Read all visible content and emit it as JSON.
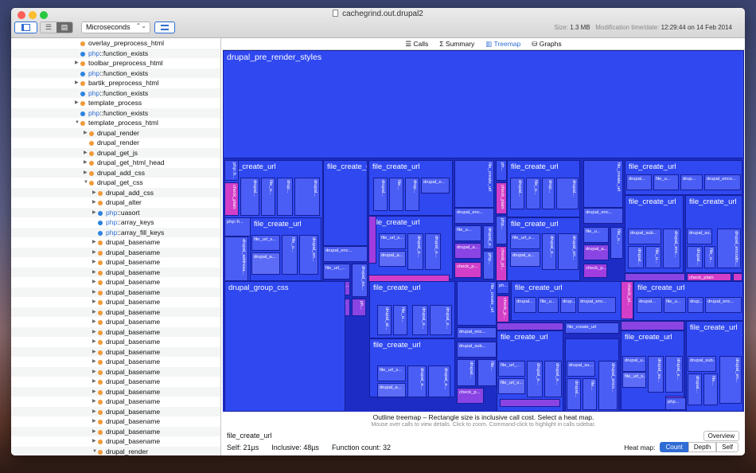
{
  "window": {
    "title": "cachegrind.out.drupal2",
    "traffic": [
      "#fc5f57",
      "#fdbc2e",
      "#28c840"
    ]
  },
  "toolbar": {
    "unit_select": "Microseconds",
    "size_label": "Size:",
    "size_value": "1.3 MB",
    "mtime_label": "Modification time/date:",
    "mtime_value": "12:29:44 on 14 Feb 2014"
  },
  "tabs": [
    "Calls",
    "Summary",
    "Treemap",
    "Graphs"
  ],
  "tab_icons": [
    "list-icon",
    "sigma-icon",
    "treemap-icon",
    "graph-icon"
  ],
  "active_tab": "Treemap",
  "sidebar": {
    "rows": [
      {
        "depth": 0,
        "tri": "",
        "dot": "o",
        "ns": "",
        "label": "overlay_preprocess_html"
      },
      {
        "depth": 0,
        "tri": "",
        "dot": "b",
        "ns": "php",
        "label": "::function_exists"
      },
      {
        "depth": 0,
        "tri": "▶",
        "dot": "o",
        "ns": "",
        "label": "toolbar_preprocess_html"
      },
      {
        "depth": 0,
        "tri": "",
        "dot": "b",
        "ns": "php",
        "label": "::function_exists"
      },
      {
        "depth": 0,
        "tri": "▶",
        "dot": "o",
        "ns": "",
        "label": "bartik_preprocess_html"
      },
      {
        "depth": 0,
        "tri": "",
        "dot": "b",
        "ns": "php",
        "label": "::function_exists"
      },
      {
        "depth": 0,
        "tri": "▶",
        "dot": "o",
        "ns": "",
        "label": "template_process"
      },
      {
        "depth": 0,
        "tri": "",
        "dot": "b",
        "ns": "php",
        "label": "::function_exists"
      },
      {
        "depth": 0,
        "tri": "▼",
        "dot": "o",
        "ns": "",
        "label": "template_process_html"
      },
      {
        "depth": 1,
        "tri": "▶",
        "dot": "o",
        "ns": "",
        "label": "drupal_render"
      },
      {
        "depth": 1,
        "tri": "",
        "dot": "o",
        "ns": "",
        "label": "drupal_render"
      },
      {
        "depth": 1,
        "tri": "▶",
        "dot": "o",
        "ns": "",
        "label": "drupal_get_js"
      },
      {
        "depth": 1,
        "tri": "▶",
        "dot": "o",
        "ns": "",
        "label": "drupal_get_html_head"
      },
      {
        "depth": 1,
        "tri": "▶",
        "dot": "o",
        "ns": "",
        "label": "drupal_add_css"
      },
      {
        "depth": 1,
        "tri": "▼",
        "dot": "o",
        "ns": "",
        "label": "drupal_get_css"
      },
      {
        "depth": 2,
        "tri": "▶",
        "dot": "o",
        "ns": "",
        "label": "drupal_add_css"
      },
      {
        "depth": 2,
        "tri": "▶",
        "dot": "o",
        "ns": "",
        "label": "drupal_alter"
      },
      {
        "depth": 2,
        "tri": "▶",
        "dot": "b",
        "ns": "php",
        "label": "::uasort"
      },
      {
        "depth": 2,
        "tri": "",
        "dot": "b",
        "ns": "php",
        "label": "::array_keys"
      },
      {
        "depth": 2,
        "tri": "",
        "dot": "b",
        "ns": "php",
        "label": "::array_fill_keys"
      },
      {
        "depth": 2,
        "tri": "▶",
        "dot": "o",
        "ns": "",
        "label": "drupal_basename"
      },
      {
        "depth": 2,
        "tri": "▶",
        "dot": "o",
        "ns": "",
        "label": "drupal_basename"
      },
      {
        "depth": 2,
        "tri": "▶",
        "dot": "o",
        "ns": "",
        "label": "drupal_basename"
      },
      {
        "depth": 2,
        "tri": "▶",
        "dot": "o",
        "ns": "",
        "label": "drupal_basename"
      },
      {
        "depth": 2,
        "tri": "▶",
        "dot": "o",
        "ns": "",
        "label": "drupal_basename"
      },
      {
        "depth": 2,
        "tri": "▶",
        "dot": "o",
        "ns": "",
        "label": "drupal_basename"
      },
      {
        "depth": 2,
        "tri": "▶",
        "dot": "o",
        "ns": "",
        "label": "drupal_basename"
      },
      {
        "depth": 2,
        "tri": "▶",
        "dot": "o",
        "ns": "",
        "label": "drupal_basename"
      },
      {
        "depth": 2,
        "tri": "▶",
        "dot": "o",
        "ns": "",
        "label": "drupal_basename"
      },
      {
        "depth": 2,
        "tri": "▶",
        "dot": "o",
        "ns": "",
        "label": "drupal_basename"
      },
      {
        "depth": 2,
        "tri": "▶",
        "dot": "o",
        "ns": "",
        "label": "drupal_basename"
      },
      {
        "depth": 2,
        "tri": "▶",
        "dot": "o",
        "ns": "",
        "label": "drupal_basename"
      },
      {
        "depth": 2,
        "tri": "▶",
        "dot": "o",
        "ns": "",
        "label": "drupal_basename"
      },
      {
        "depth": 2,
        "tri": "▶",
        "dot": "o",
        "ns": "",
        "label": "drupal_basename"
      },
      {
        "depth": 2,
        "tri": "▶",
        "dot": "o",
        "ns": "",
        "label": "drupal_basename"
      },
      {
        "depth": 2,
        "tri": "▶",
        "dot": "o",
        "ns": "",
        "label": "drupal_basename"
      },
      {
        "depth": 2,
        "tri": "▶",
        "dot": "o",
        "ns": "",
        "label": "drupal_basename"
      },
      {
        "depth": 2,
        "tri": "▶",
        "dot": "o",
        "ns": "",
        "label": "drupal_basename"
      },
      {
        "depth": 2,
        "tri": "▶",
        "dot": "o",
        "ns": "",
        "label": "drupal_basename"
      },
      {
        "depth": 2,
        "tri": "▶",
        "dot": "o",
        "ns": "",
        "label": "drupal_basename"
      },
      {
        "depth": 2,
        "tri": "▶",
        "dot": "o",
        "ns": "",
        "label": "drupal_basename"
      },
      {
        "depth": 2,
        "tri": "▼",
        "dot": "o",
        "ns": "",
        "label": "drupal_render"
      }
    ]
  },
  "treemap": {
    "root": "drupal_pre_render_styles",
    "group": "drupal_group_css",
    "fcu": "file_create_url",
    "labels": {
      "fus": "file_url_s...",
      "fu": "file_u...",
      "du": "drupal_u...",
      "de": "drupal_e...",
      "da": "drupal_a...",
      "dal": "drupal_al...",
      "den": "drupal_en...",
      "denc": "drupal_enc...",
      "dsu": "drupal_su...",
      "dsub": "drupal_sub...",
      "cp": "check_plain",
      "cpl": "check_pl...",
      "cpa": "check_p...",
      "pf": "php::fi...",
      "fl": "file_url_...",
      "dr": "drupal...",
      "dru": "drup...",
      "dea": "drupal_enco...",
      "dreg": "drupal_encodin...",
      "dab": "drupal_addreaa...",
      "ph": "ph...",
      "php": "php...",
      "fi": "file...",
      "fcul": "file_create_url"
    }
  },
  "bottom": {
    "outline": "Outline treemap – Rectangle size is inclusive call cost. Select a heat map.",
    "hint": "Mouse over calls to view details. Click to zoom. Command-click to highlight in calls sidebar.",
    "selected": "file_create_url",
    "self": "Self:  21µs",
    "inclusive": "Inclusive:  48µs",
    "count": "Function count:  32",
    "overview": "Overview",
    "heat_label": "Heat map:",
    "heat": [
      "Count",
      "Depth",
      "Self"
    ]
  }
}
